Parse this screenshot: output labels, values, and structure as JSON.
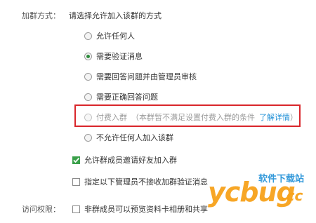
{
  "join_method": {
    "label": "加群方式：",
    "prompt": "请选择允许加入该群的方式",
    "options": [
      {
        "label": "允许任何人",
        "checked": false,
        "disabled": false
      },
      {
        "label": "需要验证消息",
        "checked": true,
        "disabled": false
      },
      {
        "label": "需要回答问题并由管理员审核",
        "checked": false,
        "disabled": false
      },
      {
        "label": "需要正确回答问题",
        "checked": false,
        "disabled": false
      },
      {
        "label": "付费入群",
        "checked": false,
        "disabled": true
      },
      {
        "label": "不允许任何人加入该群",
        "checked": false,
        "disabled": false
      }
    ],
    "paid_note": "（本群暂不满足设置付费入群的条件",
    "paid_link": "了解详情",
    "paid_note_end": "）"
  },
  "checkboxes": [
    {
      "label": "允许群成员邀请好友加入群",
      "checked": true
    },
    {
      "label": "指定以下管理员不接收加群验证消息",
      "checked": false
    }
  ],
  "access": {
    "label": "访问权限：",
    "checkbox_label": "非群成员可以预览资料卡相册和共享",
    "checked": false
  },
  "watermark": {
    "brand": "ycbug",
    "suffix": ".cc",
    "site_name": "软件下载站"
  },
  "colors": {
    "highlight_border": "#d9262b",
    "link": "#1e8fd6",
    "checked_green": "#2e8b3c",
    "watermark_orange": "#f7a21b"
  }
}
